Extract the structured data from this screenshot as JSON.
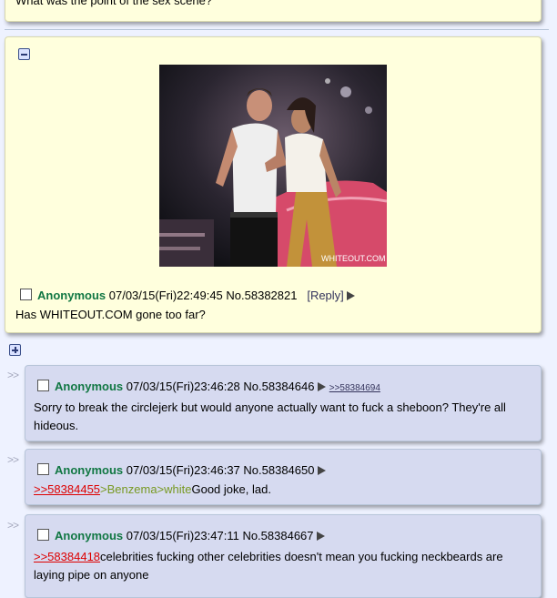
{
  "top_post": {
    "text": "What was the point of the sex scene?"
  },
  "op": {
    "name": "Anonymous",
    "datetime": "07/03/15(Fri)22:49:45",
    "post_no": "No.58382821",
    "reply_label": "[Reply]",
    "message": "Has WHITEOUT.COM gone too far?",
    "image_watermark": "WHITEOUT.COM"
  },
  "replies": [
    {
      "name": "Anonymous",
      "datetime": "07/03/15(Fri)23:46:28",
      "post_no": "No.58384646",
      "backlink": ">>58384694",
      "line1": "Sorry to break the circlejerk but would anyone actually want to fuck a sheboon? They're all",
      "line2": "hideous."
    },
    {
      "name": "Anonymous",
      "datetime": "07/03/15(Fri)23:46:37",
      "post_no": "No.58384650",
      "quote": ">>58384455",
      "green": ">Benzema>white",
      "text": "Good joke, lad."
    },
    {
      "name": "Anonymous",
      "datetime": "07/03/15(Fri)23:47:11",
      "post_no": "No.58384667",
      "quote": ">>58384418",
      "text": "celebrities fucking other celebrities doesn't mean you fucking neckbeards are",
      "line2": "laying pipe on anyone"
    }
  ],
  "reply_arrows": ">>",
  "colors": {
    "op_bg": "#ffffdd",
    "reply_bg": "#d6daf0",
    "name": "#117743",
    "quote": "#dd0000",
    "greentext": "#789922"
  },
  "icons": [
    "minus-icon",
    "plus-icon",
    "checkbox-icon",
    "menu-arrow-icon"
  ]
}
